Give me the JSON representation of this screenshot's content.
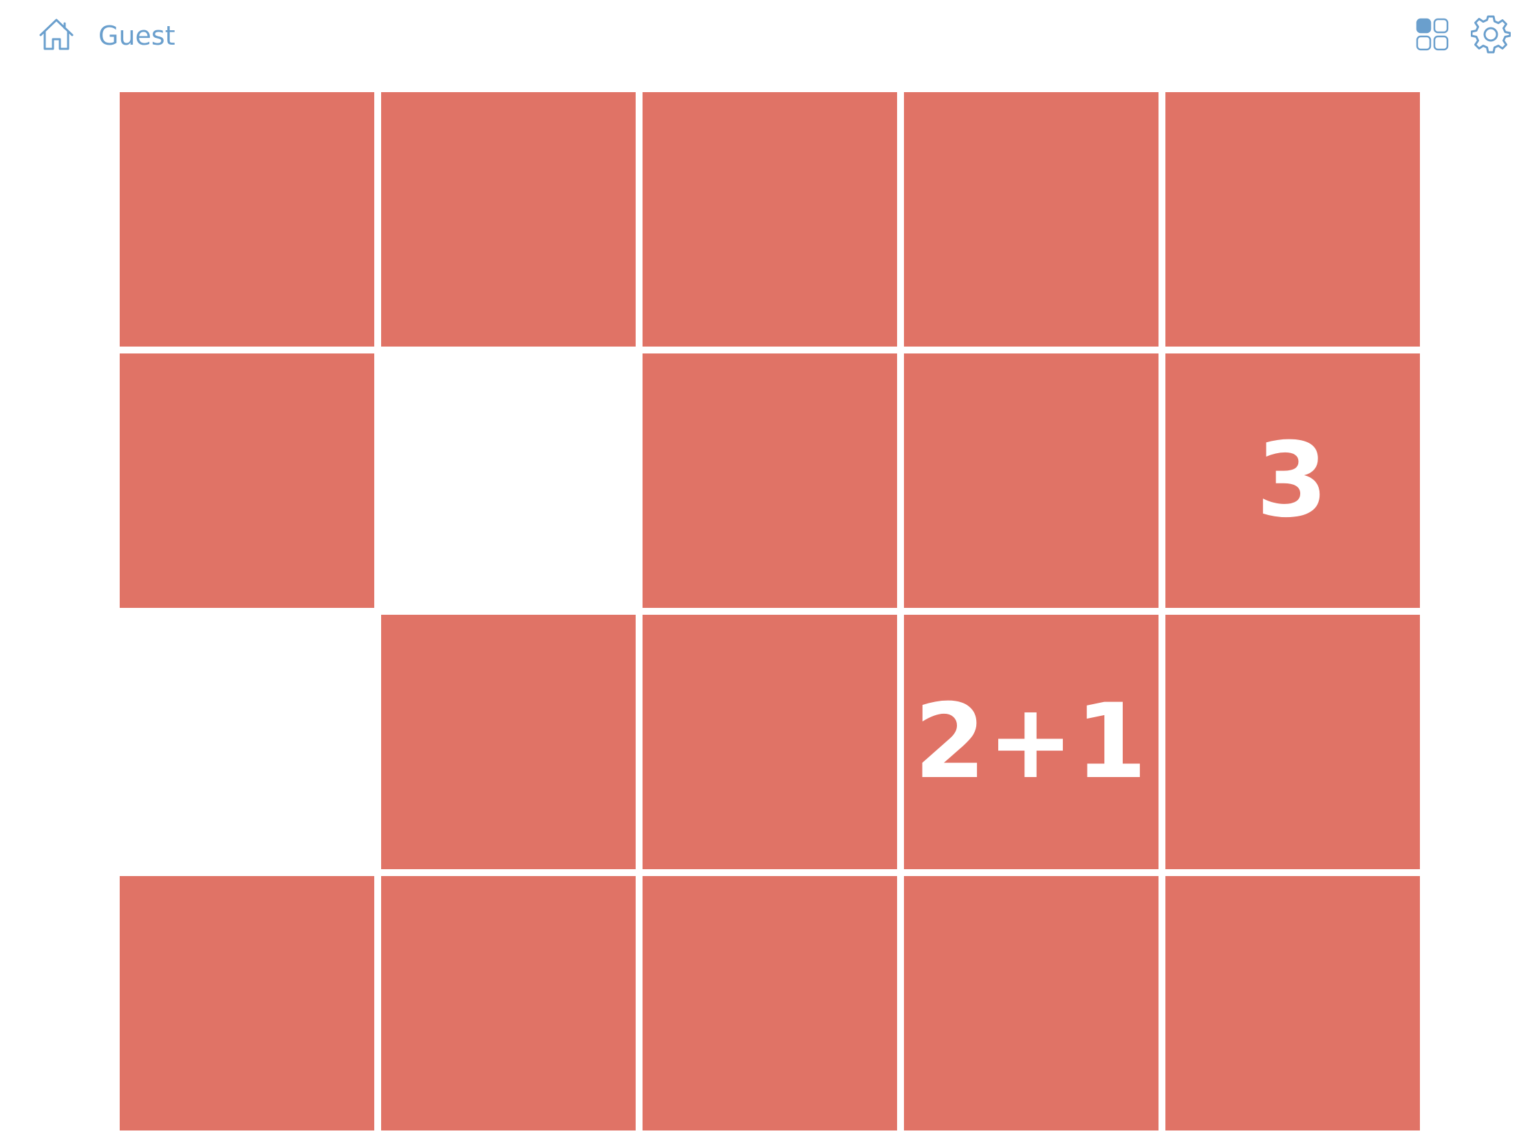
{
  "header": {
    "user_label": "Guest",
    "icons": {
      "home": "home-icon",
      "levels": "grid-icon",
      "settings": "gear-icon"
    },
    "accent_color": "#6a9fcd"
  },
  "board": {
    "tile_color": "#e07366",
    "text_color": "#ffffff",
    "rows": [
      [
        {
          "filled": true,
          "text": ""
        },
        {
          "filled": true,
          "text": ""
        },
        {
          "filled": true,
          "text": ""
        },
        {
          "filled": true,
          "text": ""
        },
        {
          "filled": true,
          "text": ""
        }
      ],
      [
        {
          "filled": true,
          "text": ""
        },
        {
          "filled": false,
          "text": ""
        },
        {
          "filled": true,
          "text": ""
        },
        {
          "filled": true,
          "text": ""
        },
        {
          "filled": true,
          "text": "3"
        }
      ],
      [
        {
          "filled": false,
          "text": ""
        },
        {
          "filled": true,
          "text": ""
        },
        {
          "filled": true,
          "text": ""
        },
        {
          "filled": true,
          "text": "2+1"
        },
        {
          "filled": true,
          "text": ""
        }
      ],
      [
        {
          "filled": true,
          "text": ""
        },
        {
          "filled": true,
          "text": ""
        },
        {
          "filled": true,
          "text": ""
        },
        {
          "filled": true,
          "text": ""
        },
        {
          "filled": true,
          "text": ""
        }
      ]
    ]
  }
}
